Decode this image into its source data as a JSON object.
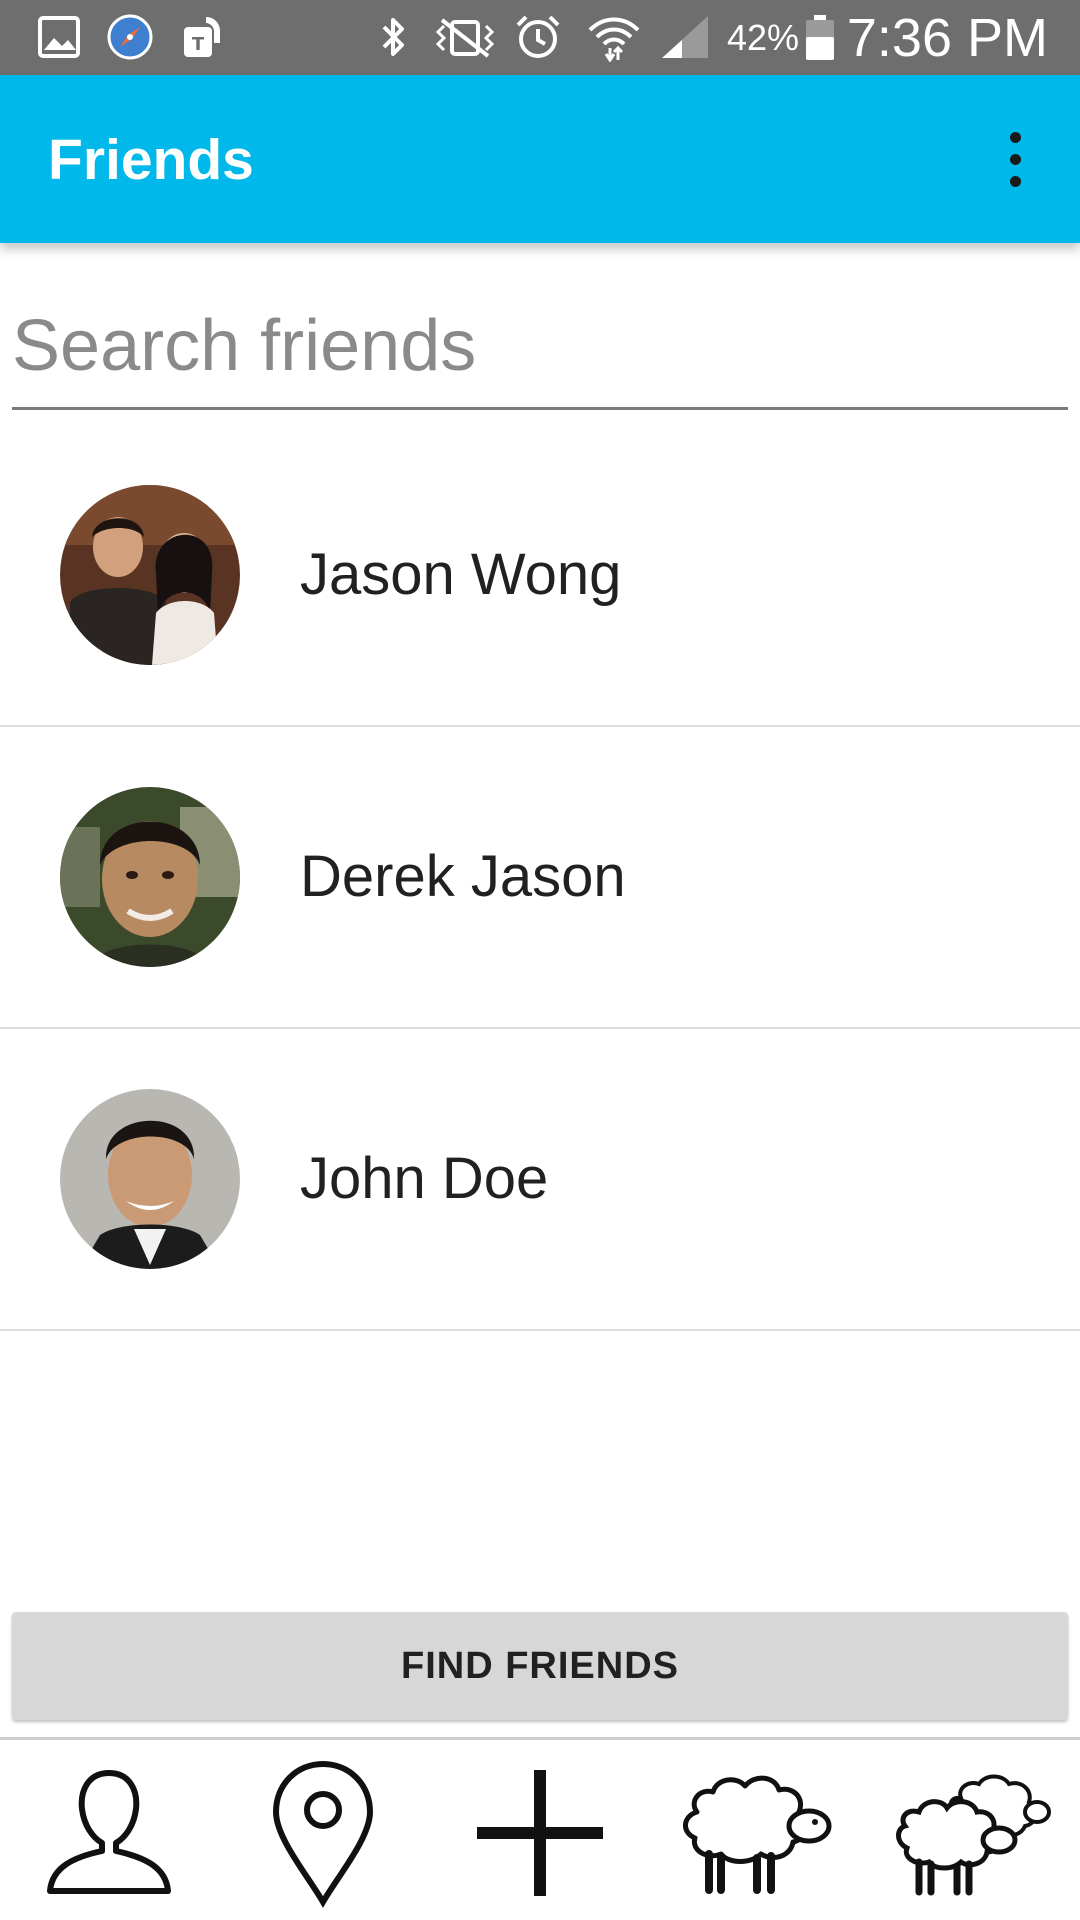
{
  "status_bar": {
    "icons": [
      "gallery-icon",
      "compass-icon",
      "carrier-app-icon",
      "bluetooth-icon",
      "vibrate-icon",
      "alarm-icon",
      "wifi-icon",
      "signal-icon",
      "battery-icon"
    ],
    "battery_percent": "42%",
    "time": "7:36 PM"
  },
  "app_bar": {
    "title": "Friends",
    "overflow_icon": "more-vert-icon"
  },
  "search": {
    "placeholder": "Search friends",
    "value": ""
  },
  "friends": [
    {
      "name": "Jason Wong"
    },
    {
      "name": "Derek Jason"
    },
    {
      "name": "John Doe"
    }
  ],
  "find_friends_button": {
    "label": "FIND FRIENDS"
  },
  "bottom_nav": {
    "items": [
      {
        "icon": "person-icon"
      },
      {
        "icon": "location-pin-icon"
      },
      {
        "icon": "plus-icon"
      },
      {
        "icon": "sheep-icon"
      },
      {
        "icon": "sheep-flock-icon"
      }
    ]
  },
  "colors": {
    "app_bar": "#00b8ea",
    "status_bar": "#6e6e6e",
    "button": "#d7d7d7",
    "divider": "#dcdcdc"
  }
}
